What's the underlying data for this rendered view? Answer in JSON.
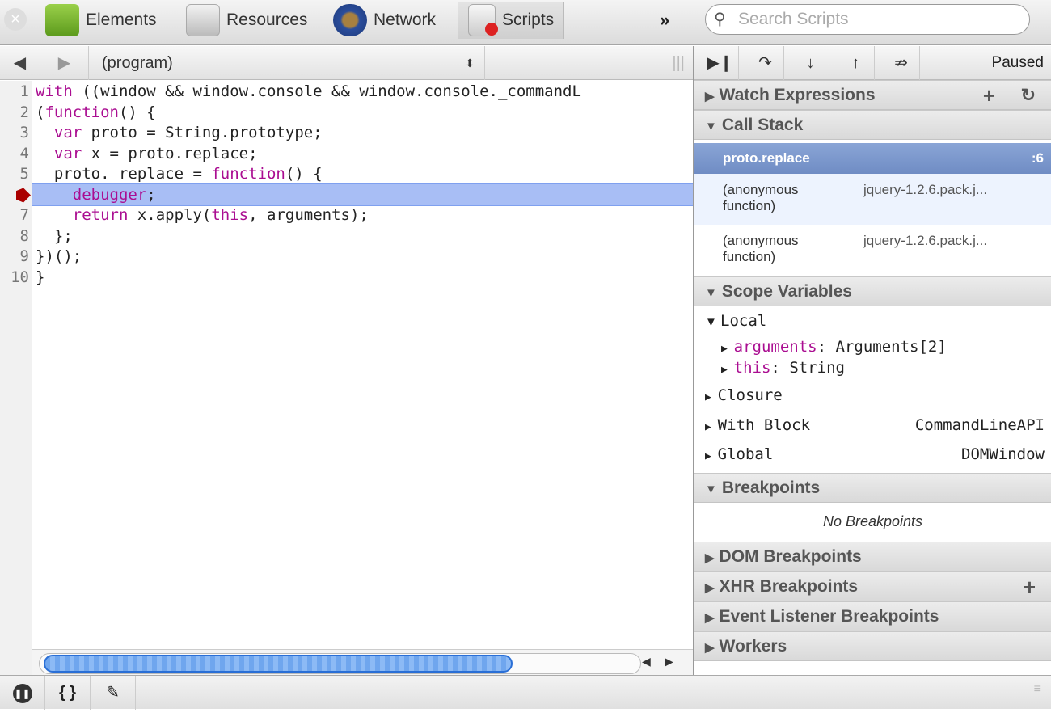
{
  "toolbar": {
    "tabs": [
      {
        "label": "Elements"
      },
      {
        "label": "Resources"
      },
      {
        "label": "Network"
      },
      {
        "label": "Scripts"
      }
    ],
    "overflow": "»",
    "search_placeholder": "Search Scripts"
  },
  "script_select": {
    "value": "(program)"
  },
  "code": {
    "lines": [
      {
        "n": "1",
        "parts": [
          {
            "t": "with",
            "k": 1
          },
          {
            "t": " ((window && window.console && window.console._commandL"
          }
        ]
      },
      {
        "n": "2",
        "parts": [
          {
            "t": "("
          },
          {
            "t": "function",
            "k": 1
          },
          {
            "t": "() {"
          }
        ]
      },
      {
        "n": "3",
        "parts": [
          {
            "t": "  "
          },
          {
            "t": "var",
            "k": 1
          },
          {
            "t": " proto = String.prototype;"
          }
        ]
      },
      {
        "n": "4",
        "parts": [
          {
            "t": "  "
          },
          {
            "t": "var",
            "k": 1
          },
          {
            "t": " x = proto.replace;"
          }
        ]
      },
      {
        "n": "5",
        "parts": [
          {
            "t": "  proto. replace = "
          },
          {
            "t": "function",
            "k": 1
          },
          {
            "t": "() {"
          }
        ]
      },
      {
        "n": "6",
        "parts": [
          {
            "t": "    "
          },
          {
            "t": "debugger",
            "k": 1
          },
          {
            "t": ";"
          }
        ]
      },
      {
        "n": "7",
        "parts": [
          {
            "t": "    "
          },
          {
            "t": "return",
            "k": 1
          },
          {
            "t": " x.apply("
          },
          {
            "t": "this",
            "k": 1
          },
          {
            "t": ", arguments);"
          }
        ]
      },
      {
        "n": "8",
        "parts": [
          {
            "t": "  };"
          }
        ]
      },
      {
        "n": "9",
        "parts": [
          {
            "t": "})();"
          }
        ]
      },
      {
        "n": "10",
        "parts": [
          {
            "t": "}"
          }
        ]
      }
    ],
    "paused_line": 6
  },
  "debugger": {
    "status": "Paused"
  },
  "sidebar": {
    "watch": "Watch Expressions",
    "call_stack": "Call Stack",
    "frames": [
      {
        "name": "proto.replace",
        "loc": ":6"
      },
      {
        "name": "(anonymous function)",
        "loc": "jquery-1.2.6.pack.j..."
      },
      {
        "name": "(anonymous function)",
        "loc": "jquery-1.2.6.pack.j..."
      }
    ],
    "scope": "Scope Variables",
    "local": "Local",
    "vars": [
      {
        "name": "arguments",
        "value": "Arguments[2]"
      },
      {
        "name": "this",
        "value": "String"
      }
    ],
    "closure": "Closure",
    "with_block": "With Block",
    "with_block_value": "CommandLineAPI",
    "global": "Global",
    "global_value": "DOMWindow",
    "breakpoints": "Breakpoints",
    "no_breakpoints": "No Breakpoints",
    "dom_breakpoints": "DOM Breakpoints",
    "xhr_breakpoints": "XHR Breakpoints",
    "event_breakpoints": "Event Listener Breakpoints",
    "workers": "Workers"
  },
  "bottom": {
    "pretty_print": "{ }"
  }
}
